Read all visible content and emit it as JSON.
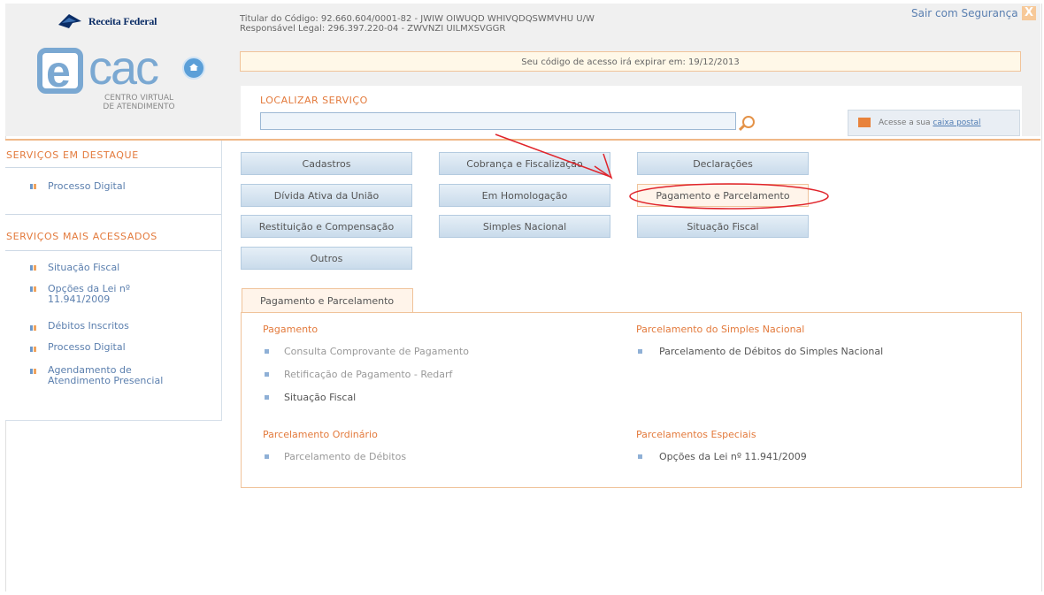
{
  "header": {
    "brand": "Receita Federal",
    "ecac_logo_text": "cac",
    "ecac_logo_letter": "e",
    "ecac_sub1": "CENTRO VIRTUAL",
    "ecac_sub2": "DE ATENDIMENTO",
    "titular_line": "Titular do Código: 92.660.604/0001-82 - JWIW OIWUQD WHIVQDQSWMVHU U/W",
    "responsavel_line": "Responsável Legal: 296.397.220-04 - ZWVNZI UILMXSVGGR",
    "logout_label": "Sair com Segurança",
    "close_glyph": "X",
    "expire_text": "Seu código de acesso irá expirar em: 19/12/2013"
  },
  "search": {
    "label": "LOCALIZAR SERVIÇO",
    "value": "",
    "mailbox_prefix": "Acesse a sua ",
    "mailbox_link": "caixa postal"
  },
  "sidebar": {
    "featured_heading": "SERVIÇOS EM DESTAQUE",
    "featured": [
      "Processo Digital"
    ],
    "most_accessed_heading": "SERVIÇOS MAIS ACESSADOS",
    "most_accessed": [
      "Situação Fiscal",
      "Opções da Lei nº",
      "11.941/2009",
      "Débitos Inscritos",
      "Processo Digital",
      "Agendamento de",
      "Atendimento Presencial"
    ]
  },
  "categories": [
    "Cadastros",
    "Cobrança e Fiscalização",
    "Declarações",
    "Dívida Ativa da União",
    "Em Homologação",
    "Pagamento e Parcelamento",
    "Restituição e Compensação",
    "Simples Nacional",
    "Situação Fiscal",
    "Outros"
  ],
  "panel": {
    "tab_label": "Pagamento e Parcelamento",
    "pagamento_heading": "Pagamento",
    "pagamento_links": [
      "Consulta Comprovante de Pagamento",
      "Retificação de Pagamento - Redarf",
      "Situação Fiscal"
    ],
    "simples_heading": "Parcelamento do Simples Nacional",
    "simples_links": [
      "Parcelamento de Débitos do Simples Nacional"
    ],
    "ordinario_heading": "Parcelamento Ordinário",
    "ordinario_links": [
      "Parcelamento de Débitos"
    ],
    "especiais_heading": "Parcelamentos Especiais",
    "especiais_links": [
      "Opções da Lei nº 11.941/2009"
    ]
  },
  "colors": {
    "accent_orange": "#e37a3c",
    "link_blue": "#5b7fae",
    "annotation_red": "#e0242b"
  }
}
